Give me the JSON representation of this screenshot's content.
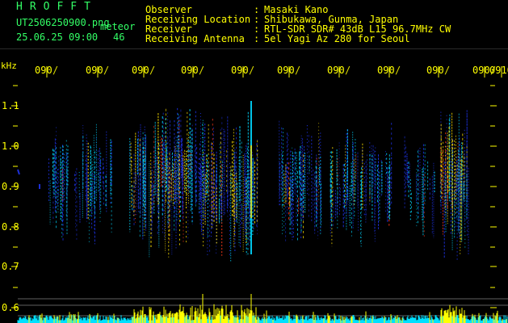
{
  "header": {
    "brand": "HROFFT",
    "filename": "UT2506250900.png",
    "timestamp": "25.06.25 09:00",
    "meteor_label": "meteor",
    "meteor_count": "46",
    "fields": [
      {
        "label": "Observer",
        "value": "Masaki Kano"
      },
      {
        "label": "Receiving Location",
        "value": "Shibukawa, Gunma, Japan"
      },
      {
        "label": "Receiver",
        "value": "RTL-SDR SDR# 43dB L15 96.7MHz CW"
      },
      {
        "label": "Receiving Antenna",
        "value": "5el Yagi Az 280 for Seoul"
      }
    ]
  },
  "axis": {
    "unit": "kHz",
    "time_ticks": [
      "0900",
      "0901",
      "0902",
      "0903",
      "0904",
      "0905",
      "0906",
      "0907",
      "0908",
      "0909",
      "0910"
    ],
    "freq_ticks": [
      "1.1",
      "1.0",
      "0.9",
      "0.8",
      "0.7",
      "0.6"
    ]
  },
  "colors": {
    "background": "#000000",
    "text_green": "#33ff66",
    "text_yellow": "#ffff00",
    "tick_yellow": "#ffff00",
    "signal_low": "#1c2fd6",
    "signal_mid": "#00d8ff",
    "signal_high": "#ffe200",
    "signal_peak": "#ff3a1a",
    "baseline_cyan": "#00e0ff",
    "baseline_yellow": "#ffff00",
    "guide_line": "#a0a0a0"
  }
}
